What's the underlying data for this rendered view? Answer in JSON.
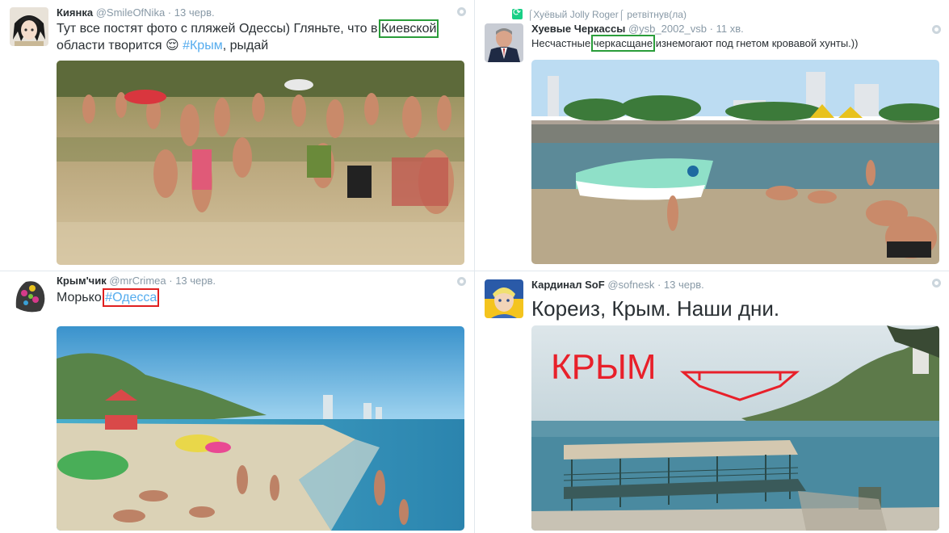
{
  "tweets": [
    {
      "fullname": "Киянка",
      "username": "@SmileOfNika",
      "time": "13 черв.",
      "text_before": "Тут все постят фото с пляжей Одессы) Гляньте, что в ",
      "text_highlight": "Киевской",
      "text_line2_before": "области творится ",
      "emoji": "😌",
      "hashtag": "#Крым",
      "text_line2_after": ", рыдай"
    },
    {
      "retweet_label": "⌠Хуёвый Jolly Roger⌠ ретвітнув(ла)",
      "fullname": "Хуевые Черкассы",
      "username": "@ysb_2002_vsb",
      "time": "11 хв.",
      "text_before": "Несчастные ",
      "text_highlight": "черкасщане",
      "text_after": " изнемогают под гнетом кровавой хунты.))"
    },
    {
      "fullname": "Крым'чик",
      "username": "@mrCrimea",
      "time": "13 черв.",
      "text_before": "Морько ",
      "text_highlight": "#Одесса"
    },
    {
      "fullname": "Кардинал SoF",
      "username": "@sofnesk",
      "time": "13 черв.",
      "text": "Кореиз, Крым. Наши дни.",
      "overlay_text": "КРЫМ"
    }
  ],
  "colors": {
    "link": "#55acee",
    "meta": "#8899a6",
    "highlight_green": "#2a9d3a",
    "highlight_red": "#e02020",
    "overlay_red": "#e8202a"
  }
}
